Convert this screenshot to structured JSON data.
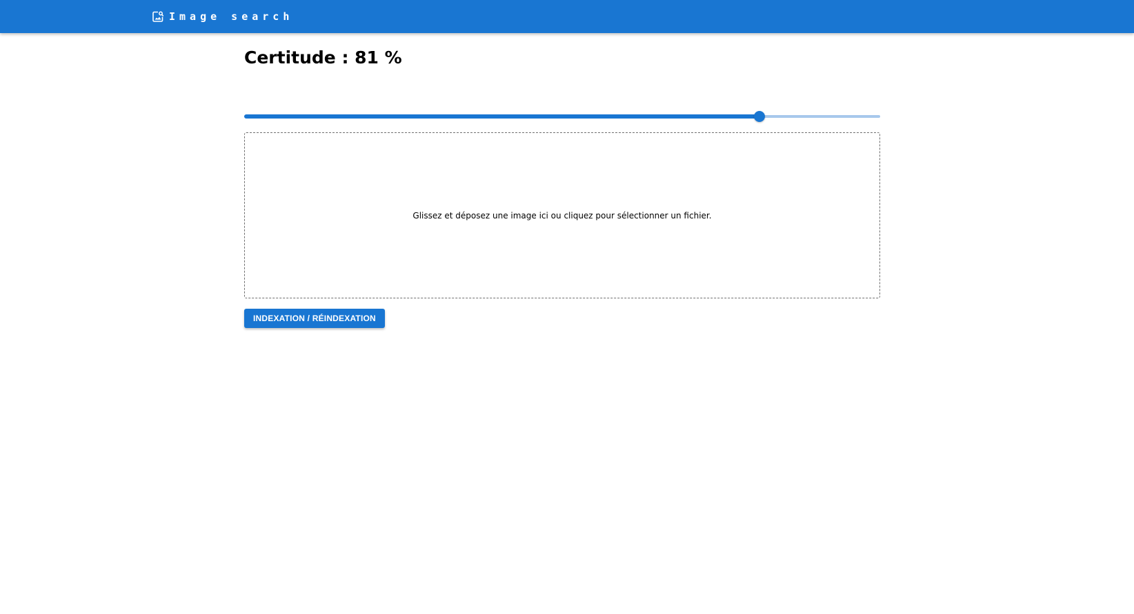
{
  "header": {
    "icon": "image-search-icon",
    "title": "Image search",
    "bar_color": "#1976d2"
  },
  "confidence": {
    "label": "Certitude : 81 %",
    "value": 81,
    "min": 0,
    "max": 100
  },
  "dropzone": {
    "hint": "Glissez et déposez une image ici ou cliquez pour sélectionner un fichier."
  },
  "actions": {
    "index_label": "INDEXATION / RÉINDEXATION"
  }
}
